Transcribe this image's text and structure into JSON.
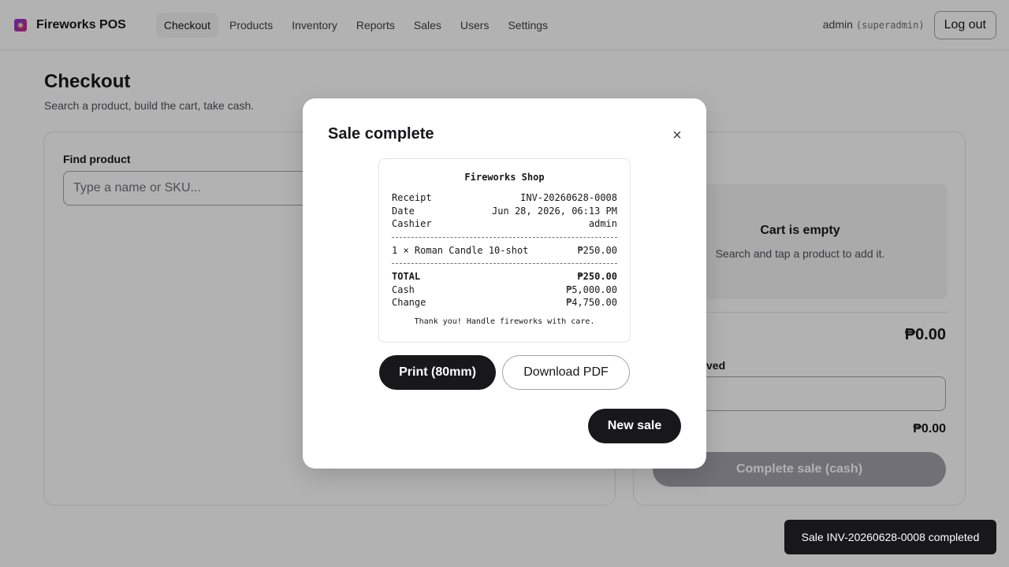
{
  "app": {
    "brand": "Fireworks POS",
    "nav": [
      "Checkout",
      "Products",
      "Inventory",
      "Reports",
      "Sales",
      "Users",
      "Settings"
    ],
    "active_nav": "Checkout",
    "user": {
      "name": "admin",
      "role": "(superadmin)"
    },
    "logout_label": "Log out"
  },
  "page": {
    "title": "Checkout",
    "subtitle": "Search a product, build the cart, take cash."
  },
  "search": {
    "label": "Find product",
    "placeholder": "Type a name or SKU..."
  },
  "cart": {
    "heading": "",
    "empty_title": "Cart is empty",
    "empty_hint": "Search and tap a product to add it.",
    "total_label": "",
    "total_value": "₱0.00",
    "cash_label": "ved",
    "change_label": "",
    "change_value": "₱0.00",
    "complete_label": "Complete sale (cash)"
  },
  "modal": {
    "title": "Sale complete",
    "close_glyph": "×",
    "receipt": {
      "shop": "Fireworks Shop",
      "meta": [
        {
          "label": "Receipt",
          "value": "INV-20260628-0008"
        },
        {
          "label": "Date",
          "value": "Jun 28, 2026, 06:13 PM"
        },
        {
          "label": "Cashier",
          "value": "admin"
        }
      ],
      "items": [
        {
          "label": "1 × Roman Candle 10-shot",
          "value": "₱250.00"
        }
      ],
      "totals": [
        {
          "label": "TOTAL",
          "value": "₱250.00"
        },
        {
          "label": "Cash",
          "value": "₱5,000.00"
        },
        {
          "label": "Change",
          "value": "₱4,750.00"
        }
      ],
      "thanks": "Thank you! Handle fireworks with care."
    },
    "print_label": "Print (80mm)",
    "pdf_label": "Download PDF",
    "new_sale_label": "New sale"
  },
  "toast": {
    "text": "Sale INV-20260628-0008 completed"
  }
}
